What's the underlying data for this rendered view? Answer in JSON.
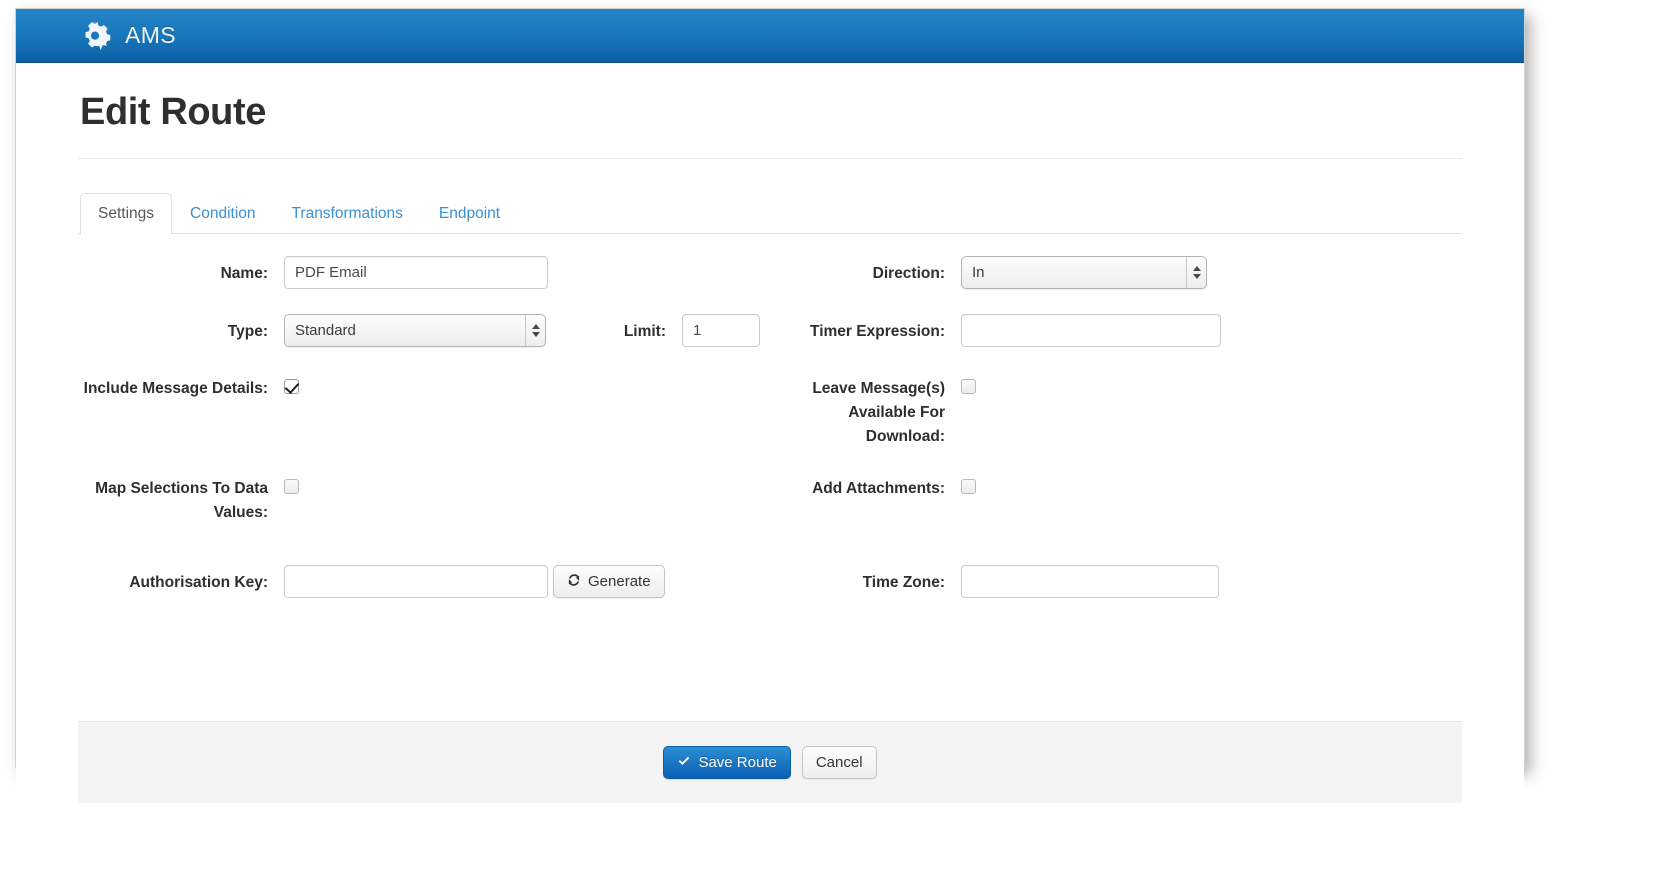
{
  "navbar": {
    "icon": "gear-icon",
    "brand": "AMS"
  },
  "page": {
    "title": "Edit Route"
  },
  "tabs": [
    {
      "label": "Settings",
      "active": true
    },
    {
      "label": "Condition",
      "active": false
    },
    {
      "label": "Transformations",
      "active": false
    },
    {
      "label": "Endpoint",
      "active": false
    }
  ],
  "form": {
    "name": {
      "label": "Name:",
      "value": "PDF Email",
      "placeholder": ""
    },
    "direction": {
      "label": "Direction:",
      "value": "In"
    },
    "type": {
      "label": "Type:",
      "value": "Standard"
    },
    "limit": {
      "label": "Limit:",
      "value": "1",
      "placeholder": ""
    },
    "timer_expression": {
      "label": "Timer Expression:",
      "value": "",
      "placeholder": ""
    },
    "include_message_details": {
      "label": "Include Message Details:",
      "checked": true
    },
    "leave_messages_available": {
      "label": "Leave Message(s) Available For Download:",
      "checked": false
    },
    "map_selections": {
      "label": "Map Selections To Data Values:",
      "checked": false
    },
    "add_attachments": {
      "label": "Add Attachments:",
      "checked": false
    },
    "authorisation_key": {
      "label": "Authorisation Key:",
      "value": "",
      "placeholder": ""
    },
    "generate_button": {
      "label": "Generate",
      "icon": "refresh-icon"
    },
    "time_zone": {
      "label": "Time Zone:",
      "value": "",
      "placeholder": ""
    }
  },
  "footer": {
    "save_label": "Save Route",
    "save_icon": "check-icon",
    "cancel_label": "Cancel"
  },
  "colors": {
    "navbar_top": "#2384c6",
    "navbar_bottom": "#0c5fa4",
    "link": "#3a90d4",
    "primary_button": "#0c5fb5",
    "footer_bg": "#f4f4f4"
  }
}
